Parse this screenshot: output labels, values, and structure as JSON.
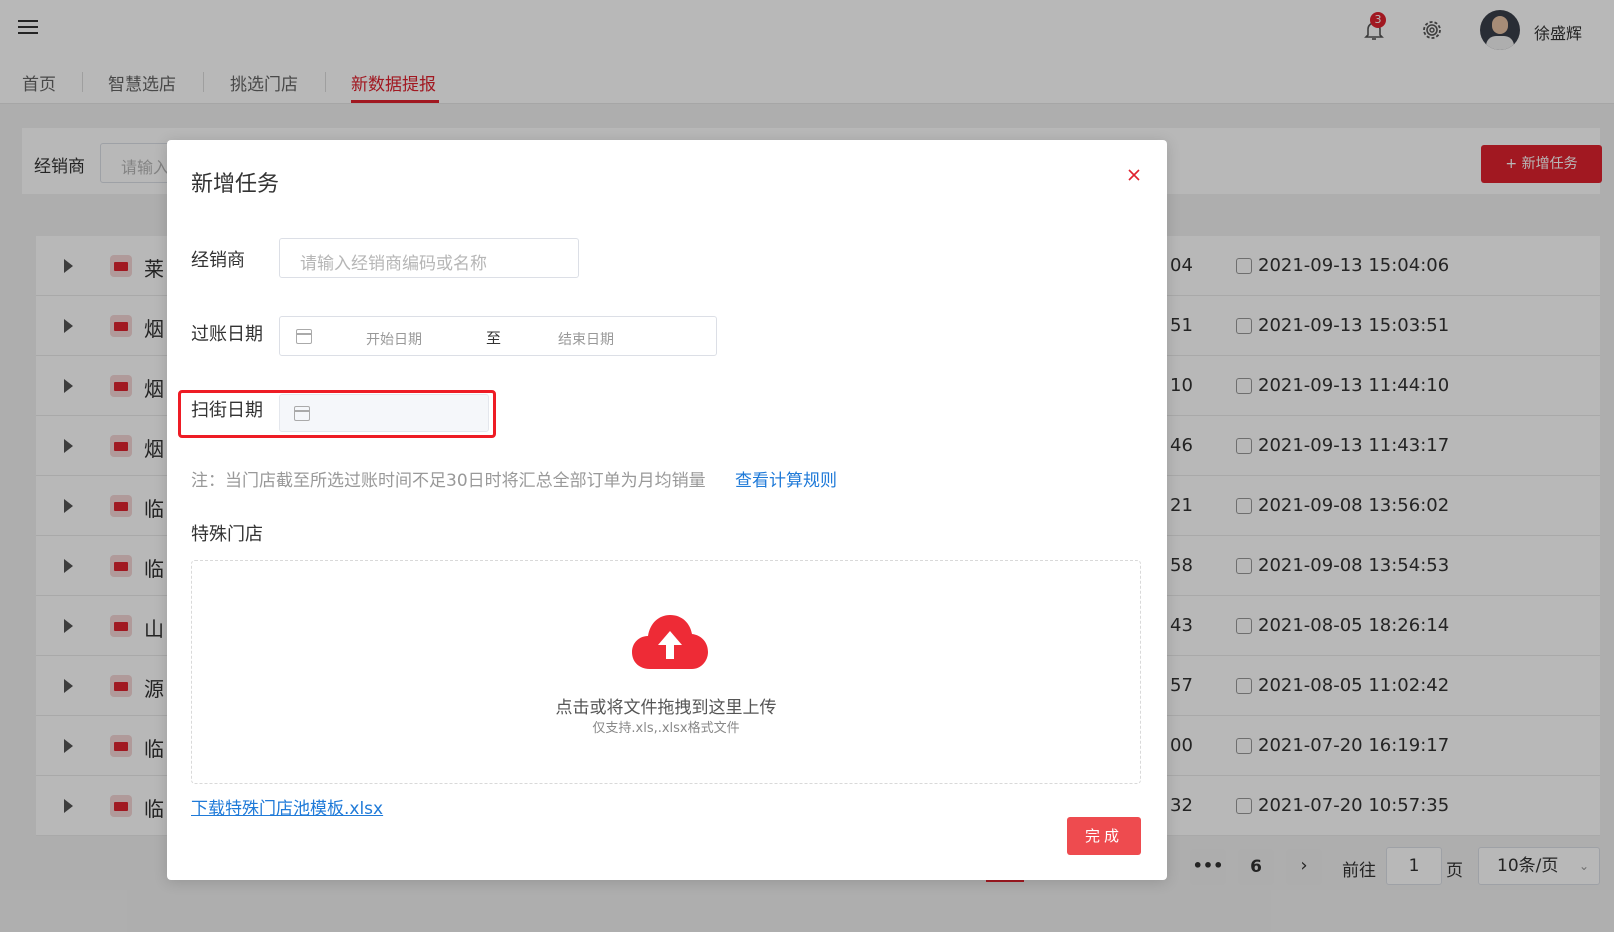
{
  "header": {
    "notification_count": "3",
    "username": "徐盛辉"
  },
  "tabs": [
    {
      "label": "首页"
    },
    {
      "label": "智慧选店"
    },
    {
      "label": "挑选门店"
    },
    {
      "label": "新数据提报",
      "active": true
    }
  ],
  "filter": {
    "dealer_label": "经销商",
    "dealer_placeholder": "请输入",
    "new_task_label": "+ 新增任务"
  },
  "table": {
    "rows": [
      {
        "name_fragment": "莱",
        "value_fragment": "04",
        "time": "2021-09-13 15:04:06"
      },
      {
        "name_fragment": "烟",
        "value_fragment": "51",
        "time": "2021-09-13 15:03:51"
      },
      {
        "name_fragment": "烟",
        "value_fragment": "10",
        "time": "2021-09-13 11:44:10"
      },
      {
        "name_fragment": "烟",
        "value_fragment": "46",
        "time": "2021-09-13 11:43:17"
      },
      {
        "name_fragment": "临",
        "value_fragment": "21",
        "time": "2021-09-08 13:56:02"
      },
      {
        "name_fragment": "临",
        "value_fragment": "58",
        "time": "2021-09-08 13:54:53"
      },
      {
        "name_fragment": "山",
        "value_fragment": "43",
        "time": "2021-08-05 18:26:14"
      },
      {
        "name_fragment": "源",
        "value_fragment": "57",
        "time": "2021-08-05 11:02:42"
      },
      {
        "name_fragment": "临",
        "value_fragment": "00",
        "time": "2021-07-20 16:19:17"
      },
      {
        "name_fragment": "临",
        "value_fragment": "32",
        "time": "2021-07-20 10:57:35"
      }
    ]
  },
  "pagination": {
    "ellipsis": "•••",
    "last_page": "6",
    "next": "›",
    "goto_label": "前往",
    "goto_value": "1",
    "page_suffix": "页",
    "page_size": "10条/页"
  },
  "modal": {
    "title": "新增任务",
    "dealer_label": "经销商",
    "dealer_placeholder": "请输入经销商编码或名称",
    "posting_date_label": "过账日期",
    "start_placeholder": "开始日期",
    "range_separator": "至",
    "end_placeholder": "结束日期",
    "scan_date_label": "扫街日期",
    "note": "注：当门店截至所选过账时间不足30日时将汇总全部订单为月均销量",
    "note_link": "查看计算规则",
    "special_store_label": "特殊门店",
    "upload_text": "点击或将文件拖拽到这里上传",
    "upload_hint": "仅支持.xls,.xlsx格式文件",
    "download_link": "下载特殊门店池模板.xlsx",
    "done_label": "完成"
  },
  "colors": {
    "brand_red": "#e0222f",
    "highlight_red": "#ee1c25",
    "link_blue": "#1f7ad8"
  }
}
